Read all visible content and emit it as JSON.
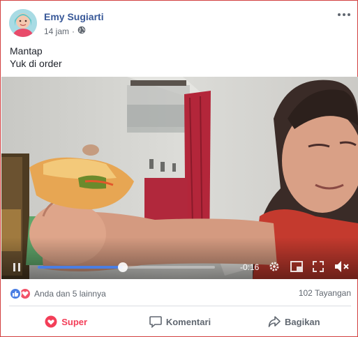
{
  "post": {
    "author": "Emy Sugiarti",
    "time": "14 jam",
    "text_line1": "Mantap",
    "text_line2": "Yuk di order"
  },
  "video": {
    "time_remaining": "-0:16",
    "progress": 0.48
  },
  "stats": {
    "reactions_text": "Anda dan 5 lainnya",
    "views_text": "102 Tayangan"
  },
  "actions": {
    "super_label": "Super",
    "comment_label": "Komentari",
    "share_label": "Bagikan"
  },
  "colors": {
    "author_link": "#385898",
    "super_red": "#f33e58",
    "like_blue": "#4a7ee3",
    "love_red": "#f25268",
    "card_border": "#d23f3f"
  }
}
